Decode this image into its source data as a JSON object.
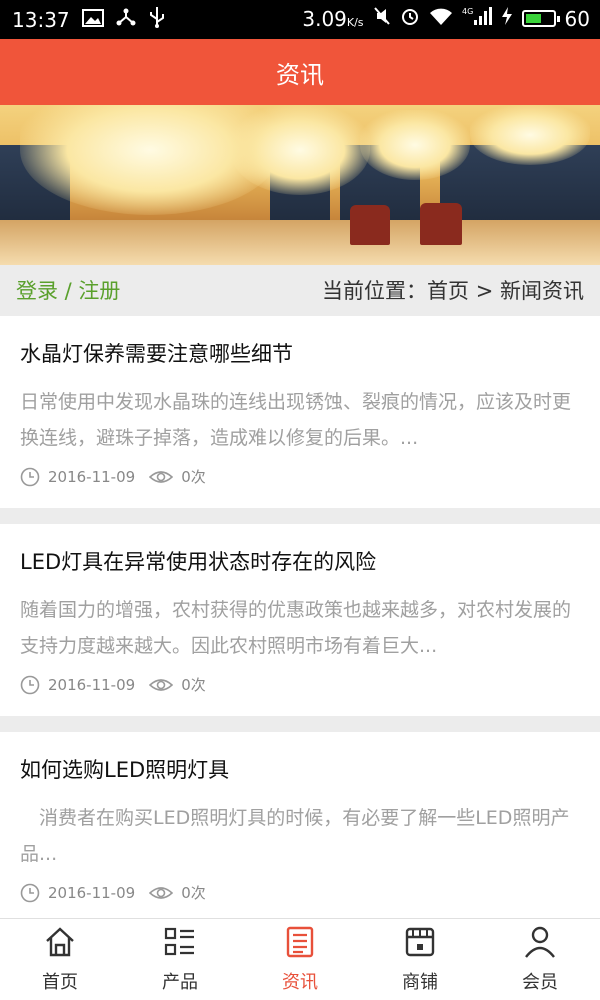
{
  "status_bar": {
    "time": "13:37",
    "speed": "3.09",
    "speed_unit": "K/s",
    "network": "4G",
    "battery": "60"
  },
  "header": {
    "title": "资讯"
  },
  "breadcrumb": {
    "login_label": "登录 / 注册",
    "location_label": "当前位置：首页 > 新闻资讯"
  },
  "articles": [
    {
      "title": "水晶灯保养需要注意哪些细节",
      "excerpt": "日常使用中发现水晶珠的连线出现锈蚀、裂痕的情况，应该及时更换连线，避珠子掉落，造成难以修复的后果。...",
      "date": "2016-11-09",
      "views": "0次"
    },
    {
      "title": "LED灯具在异常使用状态时存在的风险",
      "excerpt": "随着国力的增强，农村获得的优惠政策也越来越多，对农村发展的支持力度越来越大。因此农村照明市场有着巨大...",
      "date": "2016-11-09",
      "views": "0次"
    },
    {
      "title": "如何选购LED照明灯具",
      "excerpt": "　消费者在购买LED照明灯具的时候，有必要了解一些LED照明产品...",
      "date": "2016-11-09",
      "views": "0次"
    }
  ],
  "tabs": [
    {
      "label": "首页",
      "icon": "home-icon"
    },
    {
      "label": "产品",
      "icon": "list-icon"
    },
    {
      "label": "资讯",
      "icon": "news-icon",
      "active": true
    },
    {
      "label": "商铺",
      "icon": "store-icon"
    },
    {
      "label": "会员",
      "icon": "user-icon"
    }
  ],
  "colors": {
    "accent": "#f0553a",
    "active_tab": "#e8503a",
    "login_green": "#5aa02c"
  }
}
